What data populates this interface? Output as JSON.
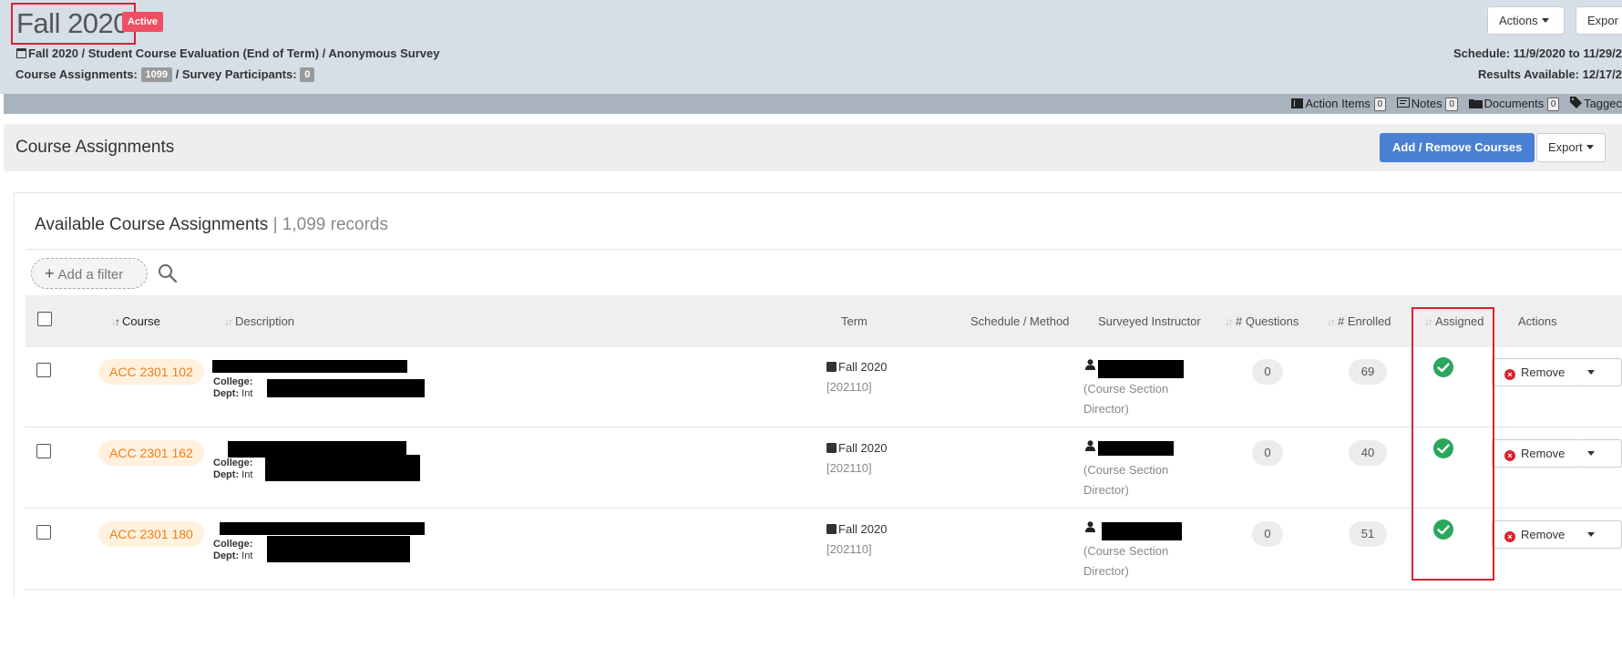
{
  "header": {
    "title": "Fall 2020",
    "status_badge": "Active",
    "breadcrumb": "Fall 2020 / Student Course Evaluation  (End of Term)  / Anonymous Survey",
    "course_assignments_label": "Course Assignments:",
    "course_assignments_count": "1099",
    "participants_label": "/ Survey Participants:",
    "participants_count": "0",
    "actions_label": "Actions",
    "export_label": "Expor",
    "schedule": "Schedule: 11/9/2020 to 11/29/2",
    "results_available": "Results Available: 12/17/2"
  },
  "subbar": {
    "action_items_label": "Action Items",
    "action_items_count": "0",
    "notes_label": "Notes",
    "notes_count": "0",
    "documents_label": "Documents",
    "documents_count": "0",
    "tagged_label": "Taggec"
  },
  "section": {
    "title": "Course Assignments",
    "add_remove_label": "Add / Remove Courses",
    "export_label": "Export"
  },
  "panel": {
    "title": "Available Course Assignments",
    "records": "| 1,099 records",
    "add_filter_label": "Add a filter"
  },
  "table": {
    "columns": {
      "course": "Course",
      "description": "Description",
      "term": "Term",
      "schedule_method": "Schedule / Method",
      "surveyed_instructor": "Surveyed Instructor",
      "questions": "# Questions",
      "enrolled": "# Enrolled",
      "assigned": "Assigned",
      "actions": "Actions"
    },
    "college_label": "College:",
    "dept_label": "Dept:",
    "dept_value_prefix": "Int",
    "remove_label": "Remove",
    "rows": [
      {
        "course": "ACC 2301 102",
        "term": "Fall 2020",
        "term_code": "[202110]",
        "instructor_role": "(Course Section Director)",
        "questions": "0",
        "enrolled": "69",
        "assigned": true
      },
      {
        "course": "ACC 2301 162",
        "term": "Fall 2020",
        "term_code": "[202110]",
        "instructor_role": "(Course Section Director)",
        "questions": "0",
        "enrolled": "40",
        "assigned": true
      },
      {
        "course": "ACC 2301 180",
        "term": "Fall 2020",
        "term_code": "[202110]",
        "instructor_role": "(Course Section Director)",
        "questions": "0",
        "enrolled": "51",
        "assigned": true
      }
    ]
  },
  "colors": {
    "header_bg": "#d6dfe8",
    "badge_red": "#ef4f63",
    "primary_blue": "#4a80d4",
    "course_orange": "#f07d1a",
    "check_green": "#2aa75a",
    "highlight_red": "#d9232e"
  }
}
